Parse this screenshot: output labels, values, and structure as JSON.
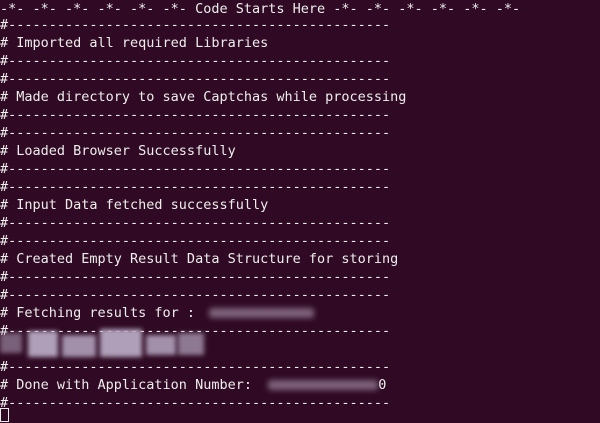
{
  "terminal": {
    "header": "-*- -*- -*- -*- -*- -*- Code Starts Here -*- -*- -*- -*- -*- -*-",
    "separator": "#-----------------------------------------------",
    "messages": {
      "m1": "# Imported all required Libraries",
      "m2": "# Made directory to save Captchas while processing",
      "m3": "# Loaded Browser Successfully",
      "m4": "# Input Data fetched successfully",
      "m5": "# Created Empty Result Data Structure for storing",
      "m6": "# Fetching results for : ",
      "m7": "# Done with Application Number:  ",
      "m7_tail": "0"
    }
  },
  "colors": {
    "background": "#300a24",
    "text": "#eeeeec"
  }
}
